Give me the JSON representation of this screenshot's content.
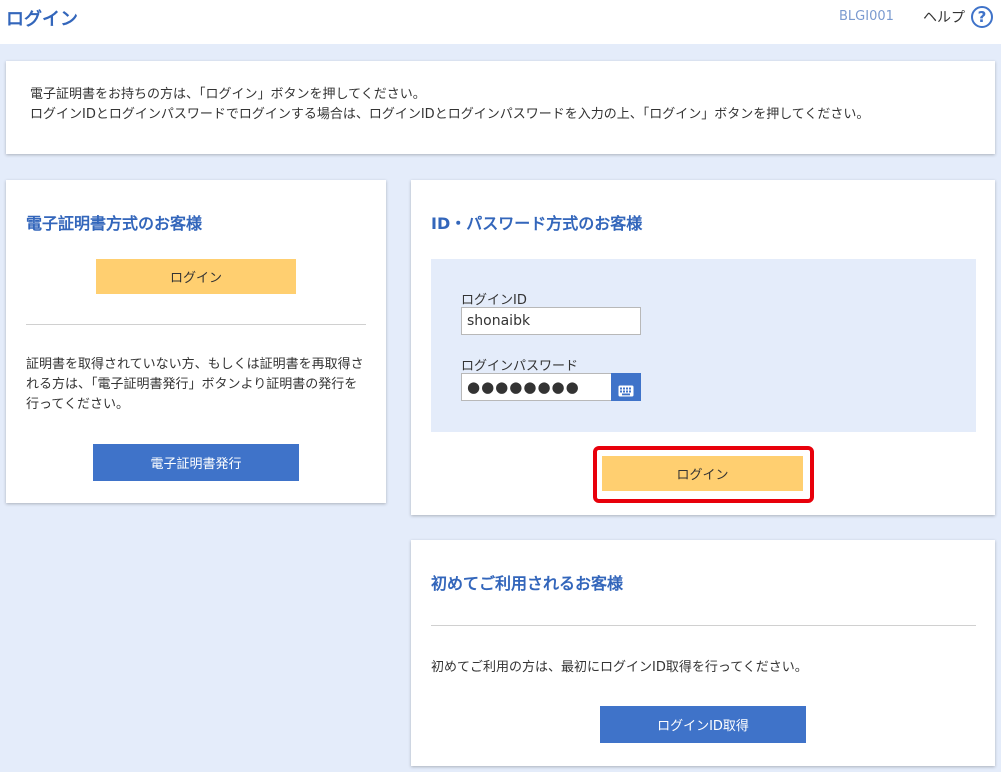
{
  "header": {
    "title": "ログイン",
    "screen_id": "BLGI001",
    "help_label": "ヘルプ",
    "help_icon_glyph": "?"
  },
  "info": {
    "line1": "電子証明書をお持ちの方は、「ログイン」ボタンを押してください。",
    "line2": "ログインIDとログインパスワードでログインする場合は、ログインIDとログインパスワードを入力の上、「ログイン」ボタンを押してください。"
  },
  "certificate": {
    "title": "電子証明書方式のお客様",
    "login_label": "ログイン",
    "description": "証明書を取得されていない方、もしくは証明書を再取得される方は、「電子証明書発行」ボタンより証明書の発行を行ってください。",
    "issue_label": "電子証明書発行"
  },
  "id_password": {
    "title": "ID・パスワード方式のお客様",
    "login_id_label": "ログインID",
    "login_id_value": "shonaibk",
    "password_label": "ログインパスワード",
    "password_value": "●●●●●●●●",
    "keyboard_icon": "keyboard-icon",
    "login_label": "ログイン"
  },
  "first_time": {
    "title": "初めてご利用されるお客様",
    "description": "初めてご利用の方は、最初にログインID取得を行ってください。",
    "acquire_label": "ログインID取得"
  },
  "colors": {
    "primary": "#3f73c9",
    "title_blue": "#3366bb",
    "button_yellow": "#ffcf70",
    "background": "#e4ecfa",
    "highlight_red": "#e8000b"
  }
}
